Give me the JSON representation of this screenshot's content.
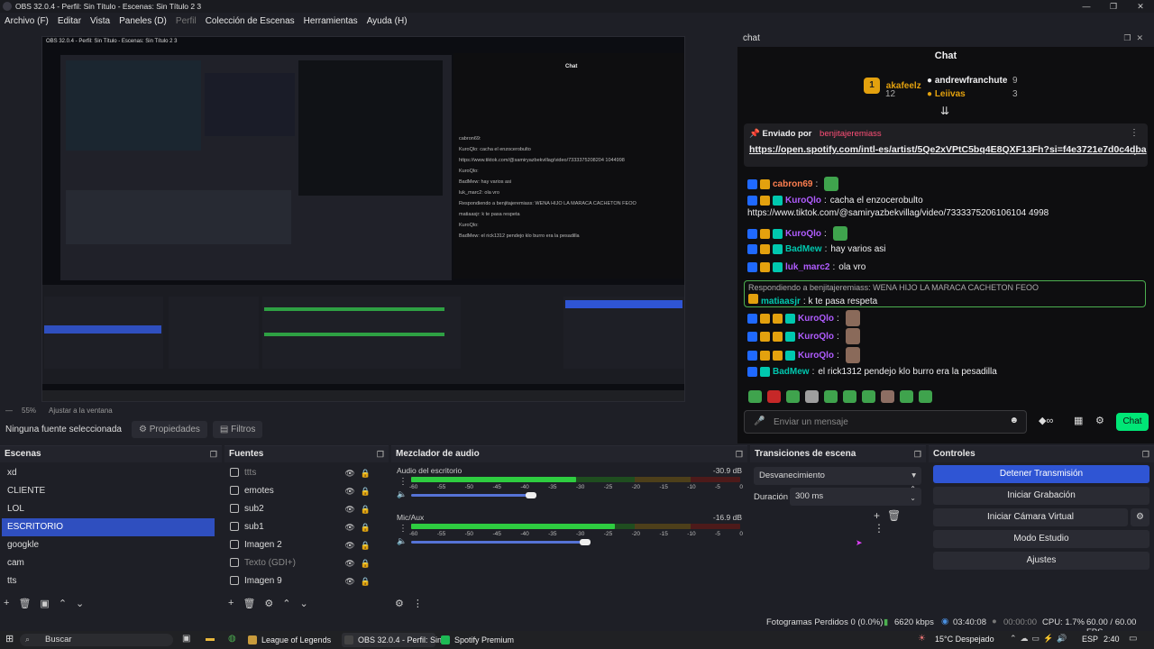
{
  "window": {
    "title": "OBS 32.0.4 - Perfil: Sin Título - Escenas: Sin Título 2 3"
  },
  "menu": [
    "Archivo (F)",
    "Editar",
    "Vista",
    "Paneles (D)",
    "Perfil",
    "Colección de Escenas",
    "Herramientas",
    "Ayuda (H)"
  ],
  "menu_dim_index": 4,
  "preview": {
    "zoom_label": "55%",
    "fit_label": "Ajustar a la ventana",
    "nested_title": "OBS 32.0.4 - Perfil: Sin Título - Escenas: Sin Título 2 3",
    "nested_chat_messages": [
      "cabron69:",
      "KuroQlo: cacha el enzocerobulto",
      "https://www.tiktok.com/@samiryazbekvillag/video/7333375208204 1044998",
      "KuroQlo:",
      "BadMew: hay varios asi",
      "luk_marc2: ola vro",
      "Respondiendo a benjitajeremiass: WENA HIJO LA MARACA CACHETON FEOO",
      "matiaasjr: k te pasa respeta",
      "KuroQlo:",
      "BadMew: el rick1312 pendejo klo burro era la pesadilla"
    ]
  },
  "chat": {
    "dock_title": "chat",
    "title": "Chat",
    "leaders": [
      {
        "rank": "1",
        "name": "akafeelz",
        "count": "12"
      },
      {
        "rank": "",
        "name": "andrewfranchute",
        "count": "9"
      },
      {
        "rank": "",
        "name": "Leiivas",
        "count": "3"
      }
    ],
    "pinned": {
      "label": "Enviado por",
      "sender": "benjitajeremiass",
      "link": "https://open.spotify.com/intl-es/artist/5Qe2xVPtC5bq4E8QXF13Fh?si=f4e3721e7d0c4dba"
    },
    "messages": [
      {
        "user": "cabron69",
        "color": "#ff7f50",
        "text": "",
        "emotes": 1
      },
      {
        "user": "KuroQlo",
        "color": "#b05cff",
        "text": "cacha el enzocerobulto",
        "emotes": 0
      },
      {
        "user": "",
        "color": "#efeff1",
        "text": "https://www.tiktok.com/@samiryazbekvillag/video/7333375206106104 4998",
        "emotes": 0
      },
      {
        "user": "KuroQlo",
        "color": "#b05cff",
        "text": "",
        "emotes": 1
      },
      {
        "user": "BadMew",
        "color": "#00c8af",
        "text": "hay varios asi",
        "emotes": 0
      },
      {
        "user": "luk_marc2",
        "color": "#b05cff",
        "text": "ola vro",
        "emotes": 0
      }
    ],
    "reply": {
      "label": "Respondiendo a benjitajeremiass: WENA HIJO LA MARACA CACHETON FEOO",
      "user": "matiaasjr",
      "text": "k te pasa respeta"
    },
    "messages2": [
      {
        "user": "KuroQlo",
        "color": "#b05cff",
        "text": ""
      },
      {
        "user": "KuroQlo",
        "color": "#b05cff",
        "text": ""
      },
      {
        "user": "KuroQlo",
        "color": "#b05cff",
        "text": ""
      },
      {
        "user": "BadMew",
        "color": "#00c8af",
        "text": "el rick1312 pendejo klo burro era la pesadilla"
      }
    ],
    "input_placeholder": "Enviar un mensaje",
    "send_label": "Chat"
  },
  "source_bar": {
    "no_source": "Ninguna fuente seleccionada",
    "properties": "Propiedades",
    "filters": "Filtros"
  },
  "scenes": {
    "title": "Escenas",
    "items": [
      "xd",
      "CLIENTE",
      "LOL",
      "ESCRITORIO",
      "googkle",
      "cam",
      "tts"
    ],
    "selected": 3
  },
  "sources": {
    "title": "Fuentes",
    "items": [
      {
        "name": "ttts",
        "dim": true
      },
      {
        "name": "emotes",
        "dim": false
      },
      {
        "name": "sub2",
        "dim": false
      },
      {
        "name": "sub1",
        "dim": false
      },
      {
        "name": "Imagen 2",
        "dim": false
      },
      {
        "name": "Texto (GDI+)",
        "dim": true
      },
      {
        "name": "Imagen 9",
        "dim": false
      }
    ]
  },
  "mixer": {
    "title": "Mezclador de audio",
    "channels": [
      {
        "name": "Audio del escritorio",
        "db": "-30.9 dB",
        "level": 0.5
      },
      {
        "name": "Mic/Aux",
        "db": "-16.9 dB",
        "level": 0.62
      }
    ],
    "ticks": [
      "-60",
      "-55",
      "-50",
      "-45",
      "-40",
      "-35",
      "-30",
      "-25",
      "-20",
      "-15",
      "-10",
      "-5",
      "0"
    ]
  },
  "transitions": {
    "title": "Transiciones de escena",
    "selected": "Desvanecimiento",
    "duration_label": "Duración",
    "duration_value": "300 ms"
  },
  "controls": {
    "title": "Controles",
    "buttons": [
      "Detener Transmisión",
      "Iniciar Grabación",
      "Iniciar Cámara Virtual",
      "Modo Estudio",
      "Ajustes"
    ]
  },
  "status": {
    "dropped": "Fotogramas Perdidos 0 (0.0%)",
    "bitrate": "6620 kbps",
    "stream_time": "03:40:08",
    "rec_time": "00:00:00",
    "cpu": "CPU: 1.7%",
    "fps": "60.00 / 60.00 FPS"
  },
  "taskbar": {
    "search": "Buscar",
    "apps": [
      "League of Legends",
      "OBS 32.0.4 - Perfil: Sin...",
      "Spotify Premium"
    ],
    "weather": "15°C  Despejado",
    "lang": "ESP",
    "time": "2:40"
  }
}
